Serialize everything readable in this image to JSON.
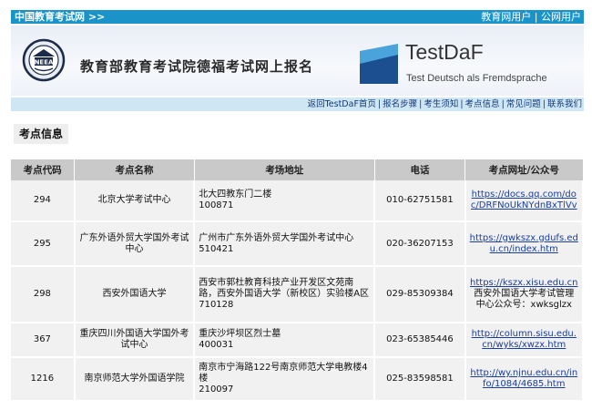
{
  "topbar": {
    "left_link": "中国教育考试网 >>",
    "right_links": [
      "教育网用户",
      "公网用户"
    ]
  },
  "banner": {
    "logo_text": "NEEA",
    "title": "教育部教育考试院德福考试网上报名",
    "testdaf_title": "TestDaF",
    "testdaf_subtitle": "Test Deutsch als Fremdsprache",
    "colors": {
      "mark_dark": "#1b4f8f",
      "mark_light": "#4ba3dc"
    }
  },
  "nav": {
    "items": [
      "返回TestDaF首页",
      "报名步骤",
      "考生须知",
      "考点信息",
      "常见问题",
      "联系我们"
    ]
  },
  "section": {
    "title": "考点信息"
  },
  "table": {
    "headers": [
      "考点代码",
      "考点名称",
      "考场地址",
      "电话",
      "考点网址/公众号"
    ],
    "rows": [
      {
        "code": "294",
        "name": "北京大学考试中心",
        "address": "北大四教东门二楼",
        "postcode": "100871",
        "phone": "010-62751581",
        "site": "https://docs.qq.com/doc/DRFNoUkNYdnBxTlVv",
        "site_extra": ""
      },
      {
        "code": "295",
        "name": "广东外语外贸大学国外考试中心",
        "address": "广州市广东外语外贸大学国外考试中心",
        "postcode": "510421",
        "phone": "020-36207153",
        "site": "https://gwkszx.gdufs.edu.cn/index.htm",
        "site_extra": ""
      },
      {
        "code": "298",
        "name": "西安外国语大学",
        "address": "西安市郭杜教育科技产业开发区文苑南路，西安外国语大学（新校区）实验楼A区",
        "postcode": "710128",
        "phone": "029-85309384",
        "site": "https://kszx.xisu.edu.cn",
        "site_extra": "西安外国语大学考试管理中心公众号：xwksglzx"
      },
      {
        "code": "367",
        "name": "重庆四川外国语大学国外考试中心",
        "address": "重庆沙坪坝区烈士墓",
        "postcode": "400031",
        "phone": "023-65385446",
        "site": "http://column.sisu.edu.cn/wyks/xwzx.htm",
        "site_extra": ""
      },
      {
        "code": "1216",
        "name": "南京师范大学外国语学院",
        "address": "南京市宁海路122号南京师范大学电教楼4楼",
        "postcode": "210097",
        "phone": "025-83598581",
        "site": "http://wy.njnu.edu.cn/info/1084/4685.htm",
        "site_extra": ""
      }
    ]
  }
}
